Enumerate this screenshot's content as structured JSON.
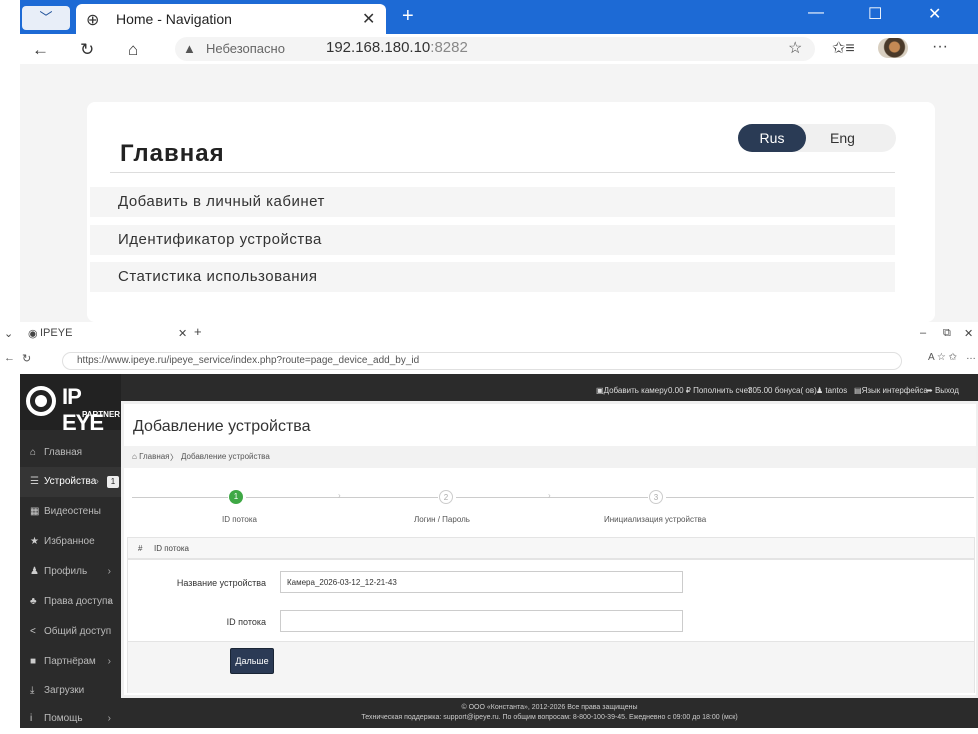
{
  "window1": {
    "tab_title": "Home - Navigation",
    "tab_close": "✕",
    "new_tab": "+",
    "address": {
      "warning": "Небезопасно",
      "host": "192.168.180.10",
      "port": ":8282"
    },
    "lang_rus": "Rus",
    "lang_eng": "Eng",
    "page_title": "Главная",
    "menu": [
      "Добавить в личный кабинет",
      "Идентификатор устройства",
      "Статистика использования"
    ]
  },
  "window2": {
    "tab_title": "IPEYE",
    "url": "https://www.ipeye.ru/ipeye_service/index.php?route=page_device_add_by_id",
    "logo_text": "IP EYE",
    "logo_sub": "PARTNER",
    "topbar": {
      "add_camera": "Добавить камеру",
      "balance": "0.00 ₽ Пополнить счет",
      "bonus": "305.00 бонуса( ов)",
      "user": "tantos",
      "lang": "Язык интерфейса",
      "logout": "Выход"
    },
    "sidebar": [
      {
        "label": "Главная",
        "icon": "home-icon"
      },
      {
        "label": "Устройства",
        "icon": "list-icon",
        "badge": "1"
      },
      {
        "label": "Видеостены",
        "icon": "grid-icon"
      },
      {
        "label": "Избранное",
        "icon": "star-icon"
      },
      {
        "label": "Профиль",
        "icon": "user-icon"
      },
      {
        "label": "Права доступа",
        "icon": "users-icon"
      },
      {
        "label": "Общий доступ",
        "icon": "share-icon"
      },
      {
        "label": "Партнёрам",
        "icon": "briefcase-icon"
      },
      {
        "label": "Загрузки",
        "icon": "download-icon"
      },
      {
        "label": "Помощь",
        "icon": "info-icon"
      }
    ],
    "page_title": "Добавление устройства",
    "breadcrumb_home": "Главная",
    "breadcrumb_current": "Добавление устройства",
    "steps": [
      {
        "num": "1",
        "label": "ID потока"
      },
      {
        "num": "2",
        "label": "Логин / Пароль"
      },
      {
        "num": "3",
        "label": "Инициализация устройства"
      }
    ],
    "form_hash": "#",
    "form_header": "ID потока",
    "device_name_label": "Название устройства",
    "device_name_value": "Камера_2026-03-12_12-21-43",
    "stream_id_label": "ID потока",
    "stream_id_value": "",
    "next_button": "Дальше",
    "footer_line1": "© ООО «Константа», 2012-2026 Все права защищены",
    "footer_line2": "Техническая поддержка: support@ipeye.ru. По общим вопросам: 8-800-100-39-45. Ежедневно с 09:00 до 18:00 (мск)"
  }
}
